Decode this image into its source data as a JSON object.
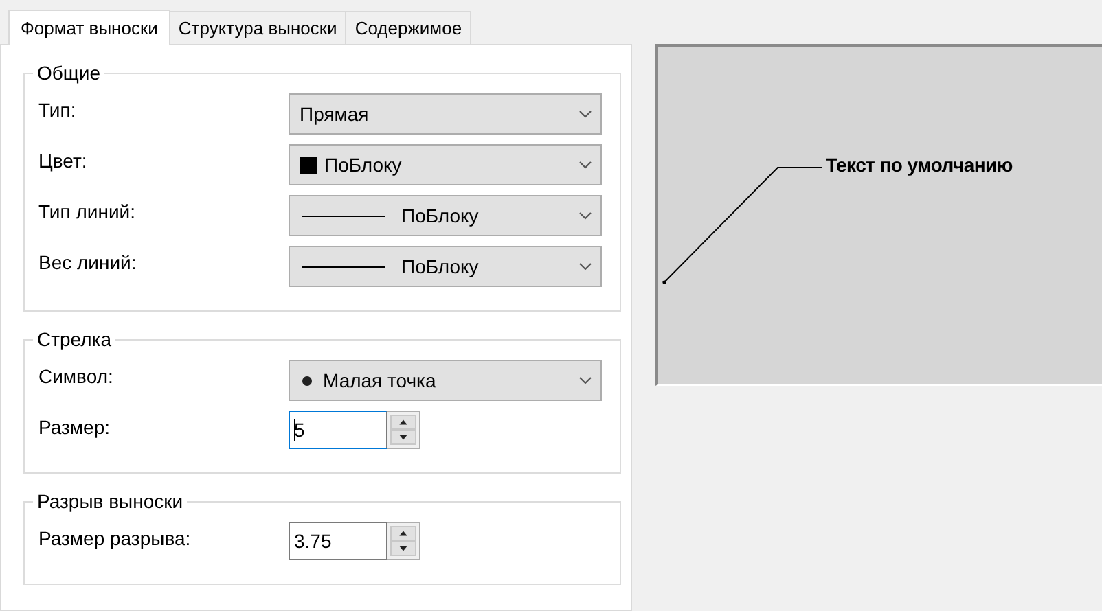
{
  "tabs": [
    {
      "label": "Формат выноски",
      "selected": true
    },
    {
      "label": "Структура выноски",
      "selected": false
    },
    {
      "label": "Содержимое",
      "selected": false
    }
  ],
  "groups": [
    {
      "title": "Общие",
      "rows": [
        {
          "label": "Тип:",
          "kind": "dropdown",
          "value": "Прямая"
        },
        {
          "label": "Цвет:",
          "kind": "swatch-dropdown",
          "value": "ПоБлоку"
        },
        {
          "label": "Тип линий:",
          "kind": "line-dropdown",
          "value": "ПоБлоку"
        },
        {
          "label": "Вес линий:",
          "kind": "line-dropdown",
          "value": "ПоБлоку"
        }
      ]
    },
    {
      "title": "Стрелка",
      "rows": [
        {
          "label": "Символ:",
          "kind": "dot-dropdown",
          "value": "Малая точка"
        },
        {
          "label": "Размер:",
          "kind": "spinner",
          "value": "5",
          "focused": true
        }
      ]
    },
    {
      "title": "Разрыв выноски",
      "rows": [
        {
          "label": "Размер разрыва:",
          "kind": "spinner",
          "value": "3.75",
          "focused": false
        }
      ]
    }
  ],
  "preview": {
    "text": "Текст по умолчанию"
  }
}
